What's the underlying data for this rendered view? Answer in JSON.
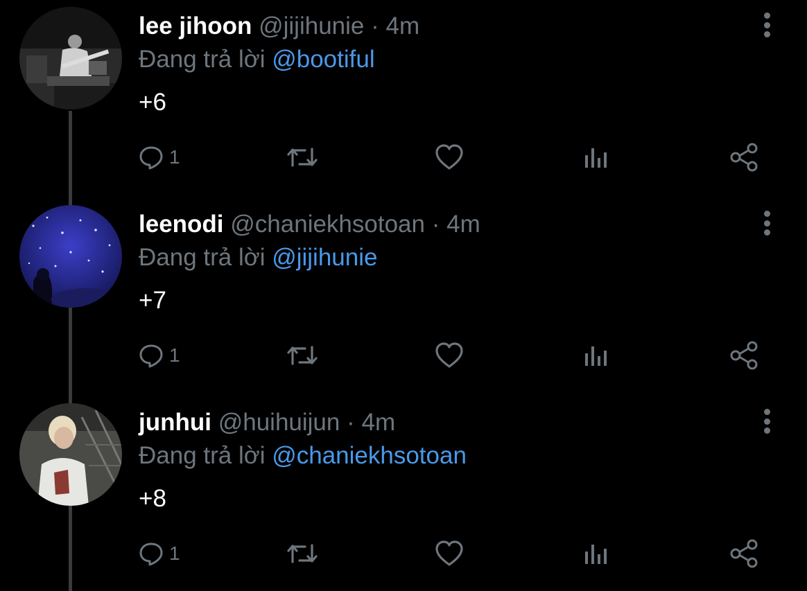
{
  "tweets": [
    {
      "display_name": "lee jihoon",
      "handle": "@jijihunie",
      "time": "· 4m",
      "reply_prefix": "Đang trả lời",
      "reply_to": "@bootiful",
      "text": "+6",
      "reply_count": "1",
      "avatar": "concert-performer-photo"
    },
    {
      "display_name": "leenodi",
      "handle": "@chaniekhsotoan",
      "time": "· 4m",
      "reply_prefix": "Đang trả lời",
      "reply_to": "@jijihunie",
      "text": "+7",
      "reply_count": "1",
      "avatar": "starry-night-photo"
    },
    {
      "display_name": "junhui",
      "handle": "@huihuijun",
      "time": "· 4m",
      "reply_prefix": "Đang trả lời",
      "reply_to": "@chaniekhsotoan",
      "text": "+8",
      "reply_count": "1",
      "avatar": "blonde-person-photo"
    }
  ],
  "icons": {
    "reply": "reply-icon",
    "retweet": "retweet-icon",
    "like": "heart-icon",
    "analytics": "analytics-icon",
    "share": "share-icon",
    "more": "more-vertical-icon"
  },
  "colors": {
    "background": "#000000",
    "primary_text": "#ffffff",
    "secondary_text": "#6e767d",
    "mention": "#4a99e9",
    "thread_line": "#3a3b3e"
  }
}
